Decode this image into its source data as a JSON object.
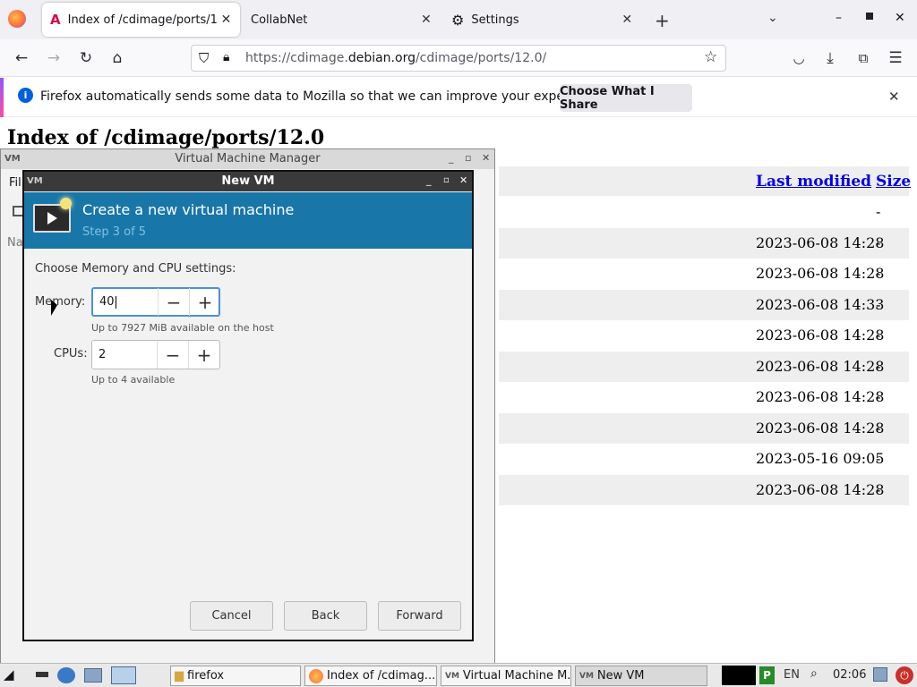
{
  "browser": {
    "tabs": [
      {
        "label": "Index of /cdimage/ports/1"
      },
      {
        "label": "CollabNet"
      },
      {
        "label": "Settings"
      }
    ],
    "url_prefix": "https://cdimage.",
    "url_domain": "debian.org",
    "url_path": "/cdimage/ports/12.0/",
    "notification": {
      "message": "Firefox automatically sends some data to Mozilla so that we can improve your experience.",
      "button": "Choose What I Share"
    }
  },
  "page": {
    "heading": "Index of /cdimage/ports/12.0",
    "columns": {
      "modified": "Last modified",
      "size": "Size"
    },
    "rows": [
      {
        "modified": "",
        "size": "-"
      },
      {
        "modified": "2023-06-08 14:28",
        "size": "-"
      },
      {
        "modified": "2023-06-08 14:28",
        "size": "-"
      },
      {
        "modified": "2023-06-08 14:33",
        "size": "-"
      },
      {
        "modified": "2023-06-08 14:28",
        "size": "-"
      },
      {
        "modified": "2023-06-08 14:28",
        "size": "-"
      },
      {
        "modified": "2023-06-08 14:28",
        "size": "-"
      },
      {
        "modified": "2023-06-08 14:28",
        "size": "-"
      },
      {
        "modified": "2023-05-16 09:05",
        "size": "-"
      },
      {
        "modified": "2023-06-08 14:28",
        "size": "-"
      }
    ]
  },
  "vmm": {
    "title": "Virtual Machine Manager",
    "menu_partial": "Fil",
    "col_partial": "Na"
  },
  "newvm": {
    "title": "New VM",
    "header": "Create a new virtual machine",
    "step": "Step 3 of 5",
    "section": "Choose Memory and CPU settings:",
    "memory_label": "Memory:",
    "memory_value": "40",
    "memory_hint": "Up to 7927 MiB available on the host",
    "cpus_label": "CPUs:",
    "cpus_value": "2",
    "cpus_hint": "Up to 4 available",
    "buttons": {
      "cancel": "Cancel",
      "back": "Back",
      "forward": "Forward"
    }
  },
  "taskbar": {
    "items": [
      "firefox",
      "Index of /cdimag...",
      "Virtual Machine M...",
      "New VM"
    ],
    "lang": "EN",
    "clock": "02:06"
  },
  "colors": {
    "banner": "#1976a8",
    "link": "#0000ee"
  }
}
